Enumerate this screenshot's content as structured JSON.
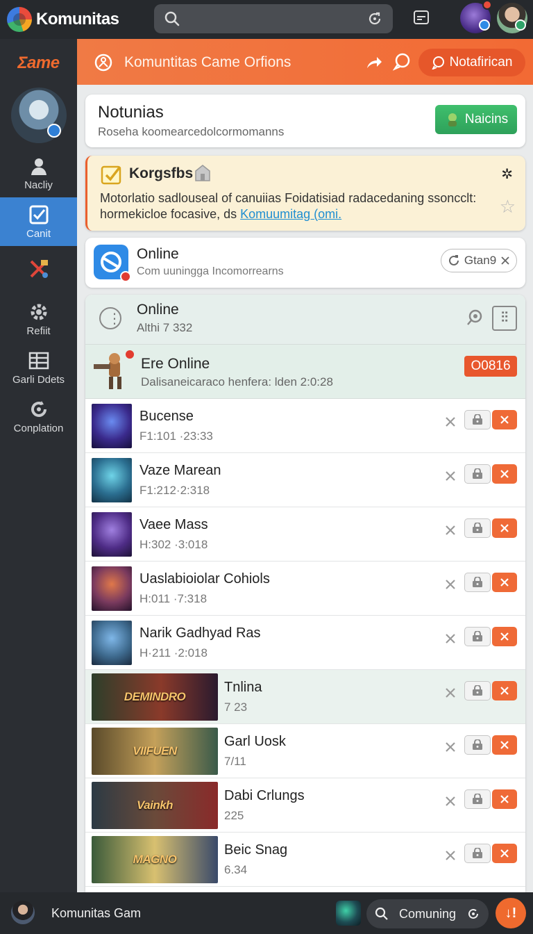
{
  "app": {
    "name": "Komunitas"
  },
  "sidebar": {
    "logo": "Σame",
    "items": [
      {
        "label": "Nacliy",
        "icon": "person-icon"
      },
      {
        "label": "Canit",
        "icon": "checkbox-icon",
        "active": true
      },
      {
        "label": "",
        "icon": "tools-icon"
      },
      {
        "label": "Refiit",
        "icon": "gear-icon"
      },
      {
        "label": "Garli Ddets",
        "icon": "table-icon"
      },
      {
        "label": "Conplation",
        "icon": "settings-refresh-icon"
      }
    ]
  },
  "header": {
    "title": "Komuntitas Came Orfions",
    "notify_label": "Notafirican",
    "accent": "#f26a34"
  },
  "card_notunias": {
    "title": "Notunias",
    "subtitle": "Roseha koomearcedolcormomanns",
    "button": "Naicins"
  },
  "announcement": {
    "title": "Korgsfbs",
    "body": "Motorlatio sadlouseal of canuiias Foidatisiad radacedaning ssoncclt: hormekicloe focasive, ds",
    "link": "Komuumitag (omi."
  },
  "online_card": {
    "title": "Online",
    "subtitle": "Com uuningga Incomorrearns",
    "pill": "Gtan9"
  },
  "list": {
    "header_title": "Online",
    "header_sub": "Althi 7 332",
    "highlight": {
      "title": "Ere Online",
      "meta": "Dalisaneicaraco henfera: lden 2:0:28",
      "code": "O0816"
    },
    "rows": [
      {
        "name": "Bucense",
        "meta": "F1:101 ·23:33"
      },
      {
        "name": "Vaze Marean",
        "meta": "F1:212·2:318"
      },
      {
        "name": "Vaee Mass",
        "meta": "H:302 ·3:018"
      },
      {
        "name": "Uaslabioiolar Cohiols",
        "meta": "H:011 ·7:318"
      },
      {
        "name": "Narik Gadhyad Ras",
        "meta": "H·211 ·2:018"
      },
      {
        "name": "Tnlina",
        "meta": "7 23",
        "banner": "DEMINDRO"
      },
      {
        "name": "Garl Uosk",
        "meta": "7/11",
        "banner": "VIIFUEN"
      },
      {
        "name": "Dabi Crlungs",
        "meta": "225",
        "banner": "Vainkh"
      },
      {
        "name": "Beic Snag",
        "meta": "6.34",
        "banner": "MAGNO"
      }
    ]
  },
  "footer": {
    "user": "Komunitas Gam",
    "search_label": "Comuning",
    "fab": "↓!"
  }
}
